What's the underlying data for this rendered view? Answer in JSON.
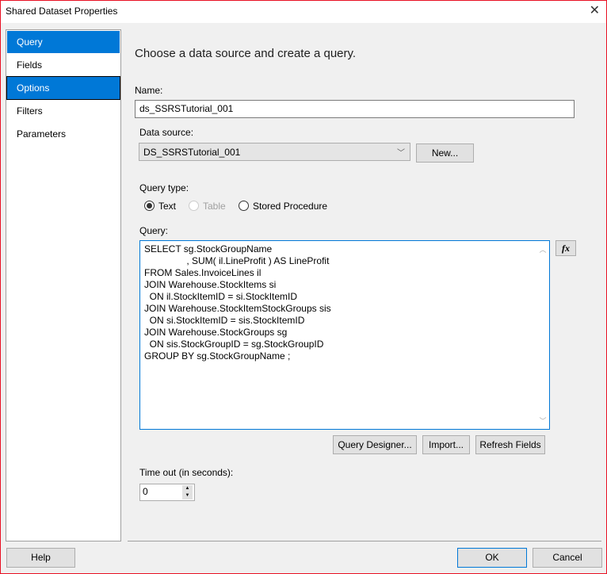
{
  "window": {
    "title": "Shared Dataset Properties",
    "close_icon": "close-icon"
  },
  "nav": {
    "items": [
      {
        "label": "Query"
      },
      {
        "label": "Fields"
      },
      {
        "label": "Options"
      },
      {
        "label": "Filters"
      },
      {
        "label": "Parameters"
      }
    ]
  },
  "main": {
    "heading": "Choose a data source and create a query.",
    "name_label": "Name:",
    "name_value": "ds_SSRSTutorial_001",
    "datasource_label": "Data source:",
    "datasource_value": "DS_SSRSTutorial_001",
    "new_button": "New...",
    "querytype_label": "Query type:",
    "querytype_options": [
      {
        "label": "Text",
        "selected": true
      },
      {
        "label": "Table",
        "disabled": true
      },
      {
        "label": "Stored Procedure"
      }
    ],
    "query_label": "Query:",
    "query_text": "SELECT sg.StockGroupName\n                , SUM( il.LineProfit ) AS LineProfit\nFROM Sales.InvoiceLines il\nJOIN Warehouse.StockItems si\n  ON il.StockItemID = si.StockItemID\nJOIN Warehouse.StockItemStockGroups sis\n  ON si.StockItemID = sis.StockItemID\nJOIN Warehouse.StockGroups sg\n  ON sis.StockGroupID = sg.StockGroupID\nGROUP BY sg.StockGroupName ;",
    "fx_button": "fx",
    "query_designer_button": "Query Designer...",
    "import_button": "Import...",
    "refresh_button": "Refresh Fields",
    "timeout_label": "Time out (in seconds):",
    "timeout_value": "0"
  },
  "footer": {
    "help": "Help",
    "ok": "OK",
    "cancel": "Cancel"
  }
}
